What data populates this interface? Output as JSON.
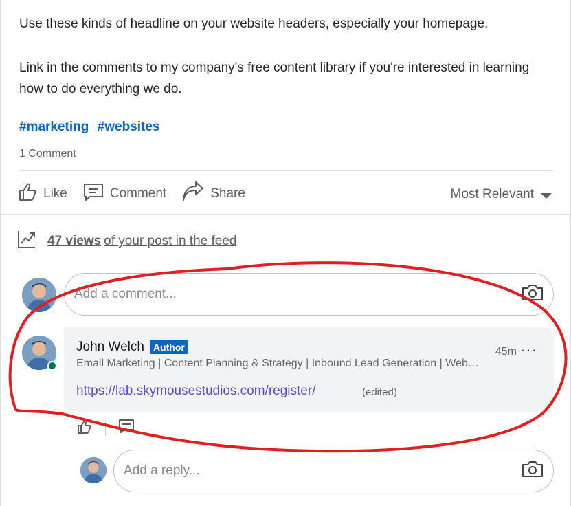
{
  "post": {
    "paragraph_1": "Use these kinds of headline on your website headers, especially your homepage.",
    "paragraph_2": "Link in the comments to my company's free content library if you're interested in learning how to do everything we do.",
    "hashtags": [
      "#marketing",
      "#websites"
    ],
    "comment_count": "1 Comment"
  },
  "actions": {
    "like": "Like",
    "comment": "Comment",
    "share": "Share",
    "sort": "Most Relevant"
  },
  "views": {
    "count": "47 views",
    "rest": "of your post in the feed"
  },
  "comment_box": {
    "placeholder": "Add a comment..."
  },
  "comment": {
    "author": "John Welch",
    "badge": "Author",
    "headline": "Email Marketing | Content Planning & Strategy | Inbound Lead Generation | Websites",
    "time": "45m",
    "more": "···",
    "link": "https://lab.skymousestudios.com/register/",
    "edited": "(edited)"
  },
  "reply_box": {
    "placeholder": "Add a reply..."
  },
  "colors": {
    "link_blue": "#0a66c2",
    "badge_blue": "#0a66c2",
    "online_green": "#057642",
    "annotation_red": "#e02020"
  },
  "icons": [
    "like-icon",
    "comment-icon",
    "share-icon",
    "caret-down-icon",
    "analytics-icon",
    "camera-icon",
    "reply-like-icon",
    "reply-comment-icon"
  ]
}
